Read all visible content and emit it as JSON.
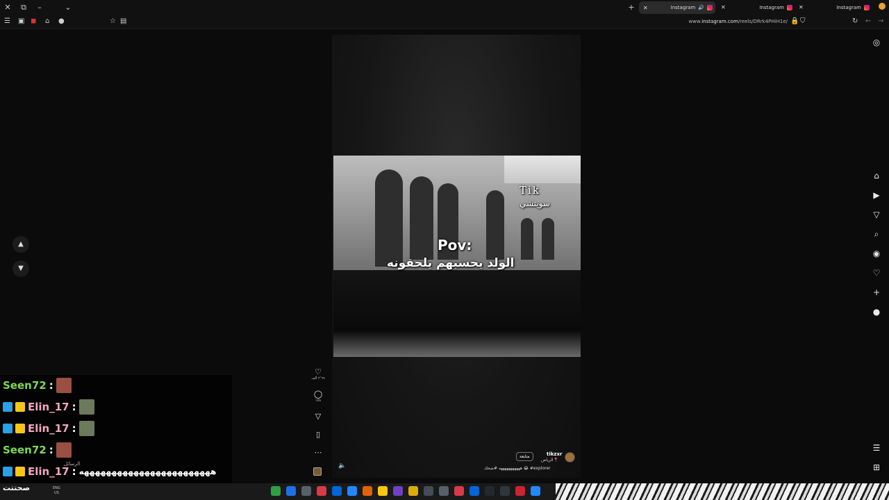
{
  "browser": {
    "tabs": [
      {
        "label": "Instagram",
        "active": true,
        "audio": true
      },
      {
        "label": "Instagram",
        "active": false
      },
      {
        "label": "Instagram",
        "active": false
      }
    ],
    "url_prefix": "www.",
    "url_host": "instagram.com",
    "url_path": "/reels/DRrk4PHiH1e/"
  },
  "reel": {
    "caption_tik": "Tik",
    "caption_sub": "سويتشي",
    "caption_pov": "Pov:",
    "caption_line": "الولد يحسبهم يلحقونه",
    "author": {
      "username": "tikzxr",
      "location": "الرياض",
      "follow_label": "متابعة",
      "caption": "هههههههههههه #ضحك 😂 #explorer"
    },
    "likes": "٢٬٦٩ ألف",
    "comments": "١٥٨",
    "icons": [
      "heart-icon",
      "comment-icon",
      "share-icon",
      "bookmark-icon",
      "more-icon"
    ]
  },
  "sidebar_icons": [
    "instagram-icon",
    "home-icon",
    "reels-icon",
    "send-icon",
    "search-icon",
    "explore-icon",
    "heart-icon",
    "create-icon",
    "profile-icon",
    "menu-icon",
    "apps-icon"
  ],
  "chat": {
    "messages": [
      {
        "user": "Seen72",
        "color": "#7ed957",
        "text": "",
        "badges": false
      },
      {
        "user": "Elin_17",
        "color": "#f2a7c3",
        "text": "",
        "badges": true
      },
      {
        "user": "Elin_17",
        "color": "#f2a7c3",
        "text": "",
        "badges": true
      },
      {
        "user": "Seen72",
        "color": "#7ed957",
        "text": "",
        "badges": false
      },
      {
        "user": "Elin_17",
        "color": "#f2a7c3",
        "text": "ههههههههههههههههههههههههه",
        "badges": true
      }
    ],
    "separator": " : ",
    "messages_label": "الرسائل"
  },
  "taskbar": {
    "corner_text": "صحتتت",
    "lang_1": "ENG",
    "lang_2": "US"
  }
}
